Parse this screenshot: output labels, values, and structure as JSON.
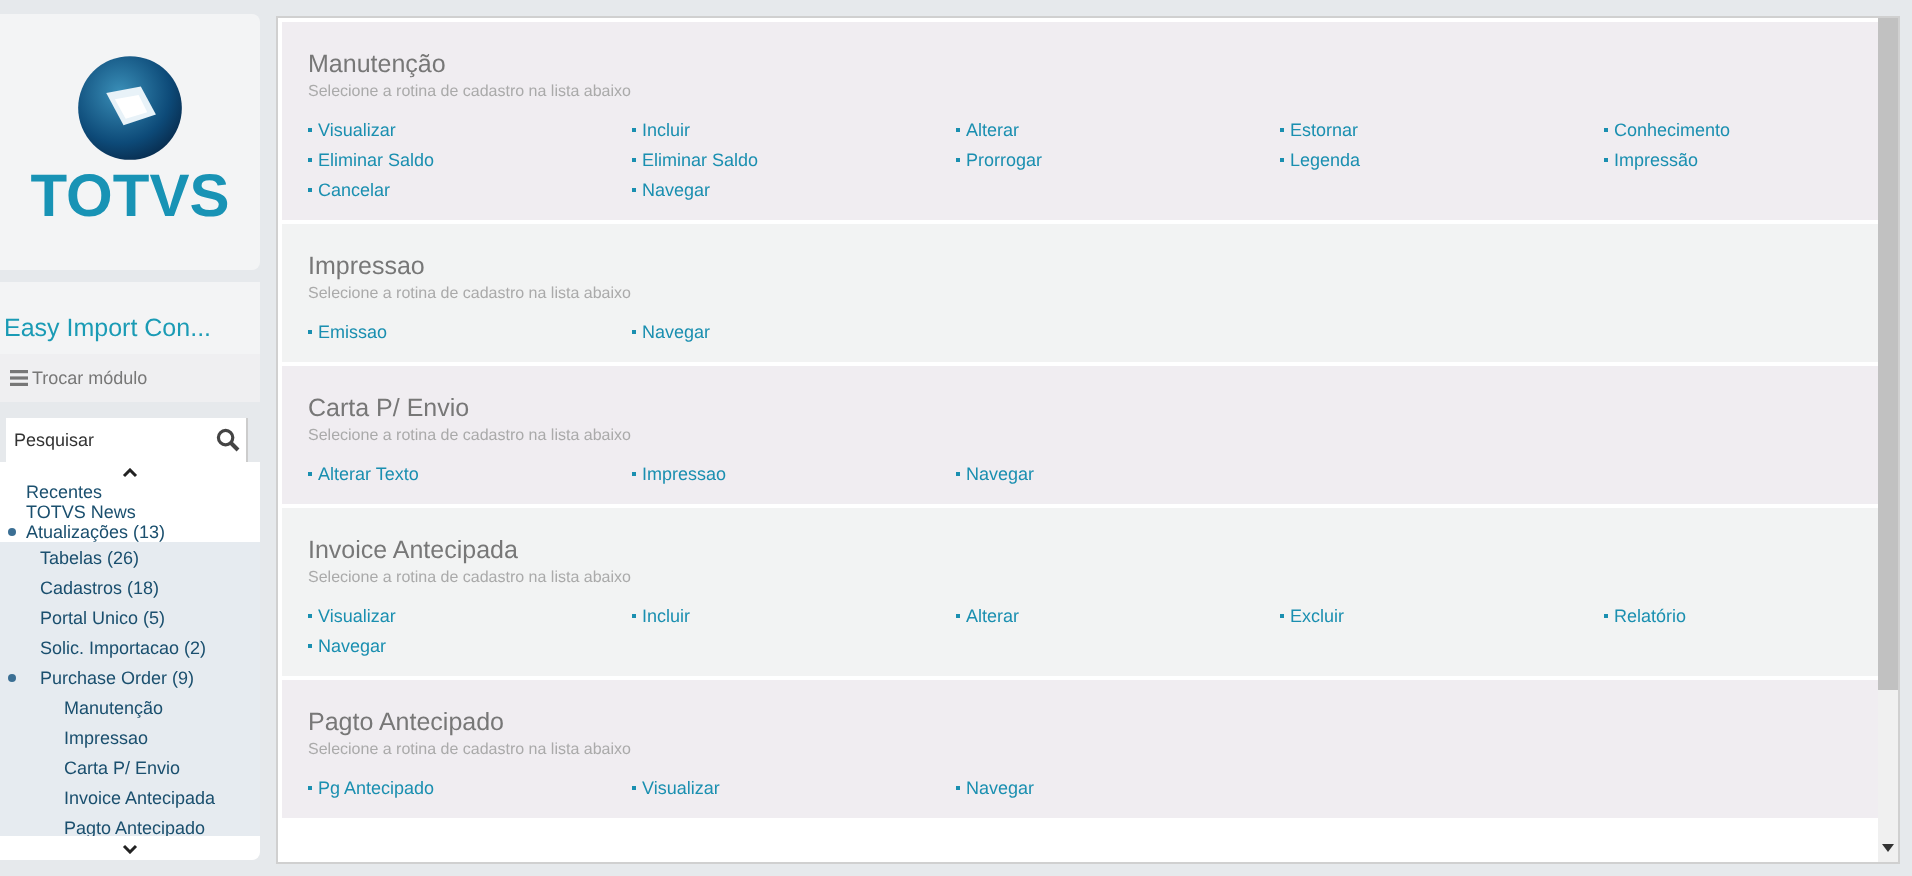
{
  "sidebar": {
    "logo_text": "TOTVS",
    "module_title": "Easy Import Con...",
    "switch_module": "Trocar módulo",
    "search": {
      "placeholder": "Pesquisar"
    },
    "tree": [
      {
        "label": "Recentes",
        "expanded": false
      },
      {
        "label": "TOTVS News",
        "expanded": false
      },
      {
        "label": "Atualizações (13)",
        "expanded": true,
        "children": [
          {
            "label": "Tabelas (26)",
            "expanded": false
          },
          {
            "label": "Cadastros (18)",
            "expanded": false
          },
          {
            "label": "Portal Unico (5)",
            "expanded": false
          },
          {
            "label": "Solic. Importacao (2)",
            "expanded": false
          },
          {
            "label": "Purchase Order (9)",
            "expanded": true,
            "children": [
              {
                "label": "Manutenção"
              },
              {
                "label": "Impressao"
              },
              {
                "label": "Carta P/ Envio"
              },
              {
                "label": "Invoice Antecipada"
              },
              {
                "label": "Pagto Antecipado"
              }
            ]
          }
        ]
      }
    ]
  },
  "sections": [
    {
      "title": "Manutenção",
      "subtitle": "Selecione a rotina de cadastro na lista abaixo",
      "links": [
        "Visualizar",
        "Incluir",
        "Alterar",
        "Estornar",
        "Conhecimento",
        "Eliminar Saldo",
        "Eliminar Saldo",
        "Prorrogar",
        "Legenda",
        "Impressão",
        "Cancelar",
        "Navegar"
      ]
    },
    {
      "title": "Impressao",
      "subtitle": "Selecione a rotina de cadastro na lista abaixo",
      "links": [
        "Emissao",
        "Navegar"
      ]
    },
    {
      "title": "Carta P/ Envio",
      "subtitle": "Selecione a rotina de cadastro na lista abaixo",
      "links": [
        "Alterar Texto",
        "Impressao",
        "Navegar"
      ]
    },
    {
      "title": "Invoice Antecipada",
      "subtitle": "Selecione a rotina de cadastro na lista abaixo",
      "links": [
        "Visualizar",
        "Incluir",
        "Alterar",
        "Excluir",
        "Relatório",
        "Navegar"
      ]
    },
    {
      "title": "Pagto Antecipado",
      "subtitle": "Selecione a rotina de cadastro na lista abaixo",
      "links": [
        "Pg Antecipado",
        "Visualizar",
        "Navegar"
      ]
    }
  ]
}
